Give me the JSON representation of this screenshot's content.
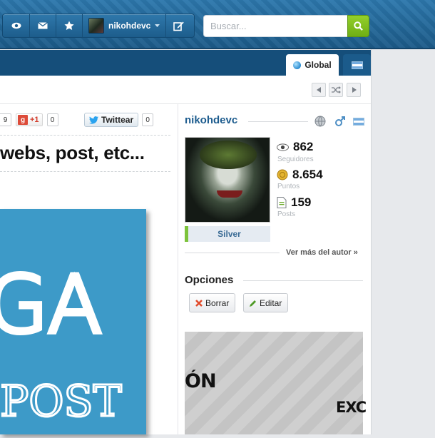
{
  "topbar": {
    "username": "nikohdevc",
    "search_placeholder": "Buscar...",
    "icons": [
      "eye-icon",
      "mail-icon",
      "star-icon",
      "chevron-down-icon",
      "edit-icon",
      "search-icon"
    ]
  },
  "tabs": {
    "global_label": "Global",
    "country_flag": "argentina-flag-icon"
  },
  "share": {
    "partial_count": "9",
    "gplus_label": "+1",
    "gplus_count": "0",
    "twitter_label": "Twittear",
    "twitter_count": "0"
  },
  "post": {
    "title_fragment": "webs, post, etc...",
    "image_text_1": "GA",
    "image_text_2": "POST"
  },
  "author": {
    "name": "nikohdevc",
    "rank": "Silver",
    "followers_value": "862",
    "followers_label": "Seguidores",
    "points_value": "8.654",
    "points_label": "Puntos",
    "posts_value": "159",
    "posts_label": "Posts",
    "more_link": "Ver más del autor »"
  },
  "options": {
    "heading": "Opciones",
    "delete_label": "Borrar",
    "edit_label": "Editar"
  },
  "banner": {
    "text_1": "ÓN",
    "text_2": "EXC"
  },
  "colors": {
    "header_blue": "#1e5f8e",
    "search_green": "#7dbb1e",
    "link_blue": "#1d5c8e",
    "rank_green": "#7dc33b"
  }
}
